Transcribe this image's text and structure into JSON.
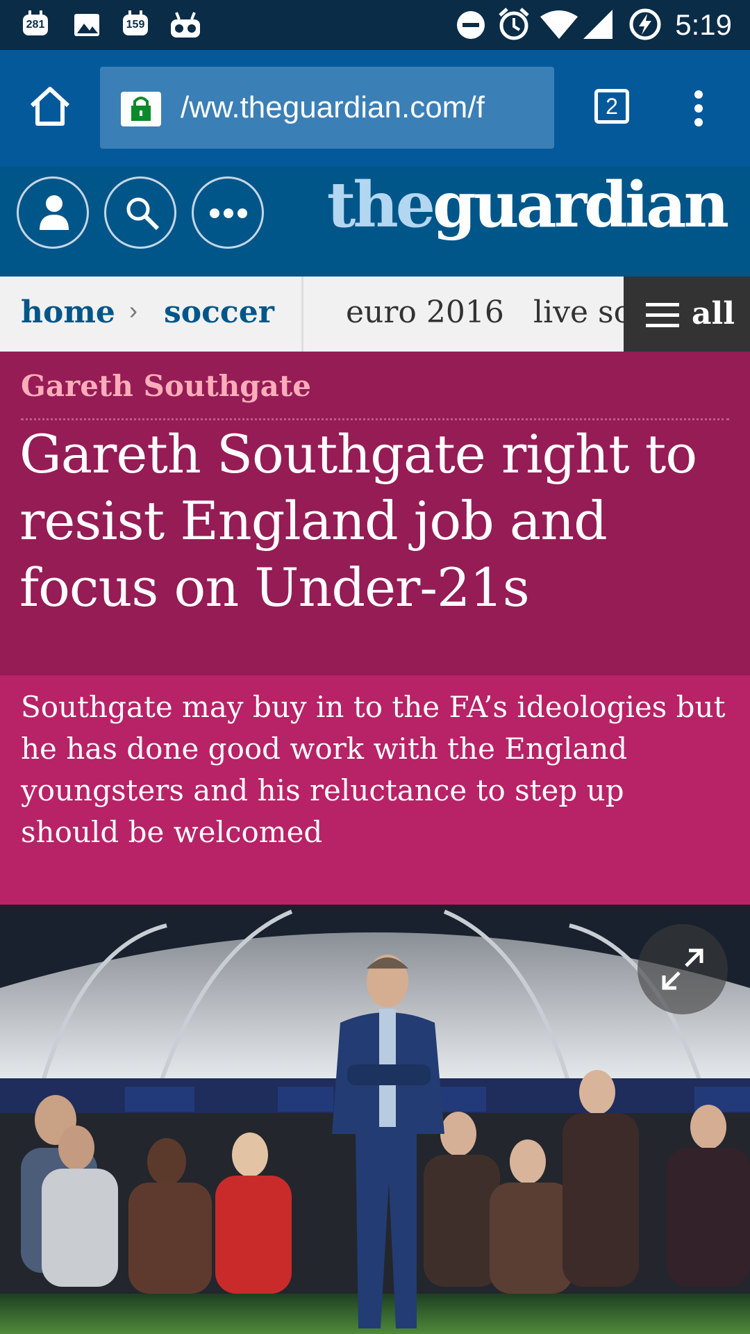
{
  "status_bar": {
    "notifications": [
      "281",
      "159"
    ],
    "time": "5:19"
  },
  "browser": {
    "url": "/ww.theguardian.com/f",
    "tab_count": "2"
  },
  "site": {
    "logo_the": "the",
    "logo_guardian": "guardian"
  },
  "nav": {
    "home": "home",
    "chevron": "›",
    "section": "soccer",
    "items": [
      "euro 2016",
      "live sc"
    ],
    "all_label": "all"
  },
  "article": {
    "kicker": "Gareth Southgate",
    "headline": "Gareth Southgate right to resist England job and focus on Under-21s",
    "standfirst": "Southgate may buy in to the FA’s ideologies but he has done good work with the England youngsters and his reluctance to step up should be welcomed"
  },
  "colors": {
    "status_bar": "#0a2c47",
    "browser_bar": "#04599b",
    "guardian_blue": "#005689",
    "headline_bg": "#951c55",
    "standfirst_bg": "#b82266",
    "kicker": "#fdadba"
  },
  "icons": {
    "status_left": [
      "calendar-icon",
      "image-icon",
      "calendar-icon",
      "vr-icon"
    ],
    "status_right": [
      "do-not-disturb-icon",
      "alarm-icon",
      "wifi-icon",
      "signal-icon",
      "battery-saver-icon"
    ],
    "browser": [
      "home-icon",
      "lock-icon",
      "tabs-icon",
      "more-vert-icon"
    ],
    "header": [
      "profile-icon",
      "search-icon",
      "more-horiz-icon"
    ],
    "nav": [
      "menu-icon"
    ],
    "image": [
      "expand-icon"
    ]
  }
}
